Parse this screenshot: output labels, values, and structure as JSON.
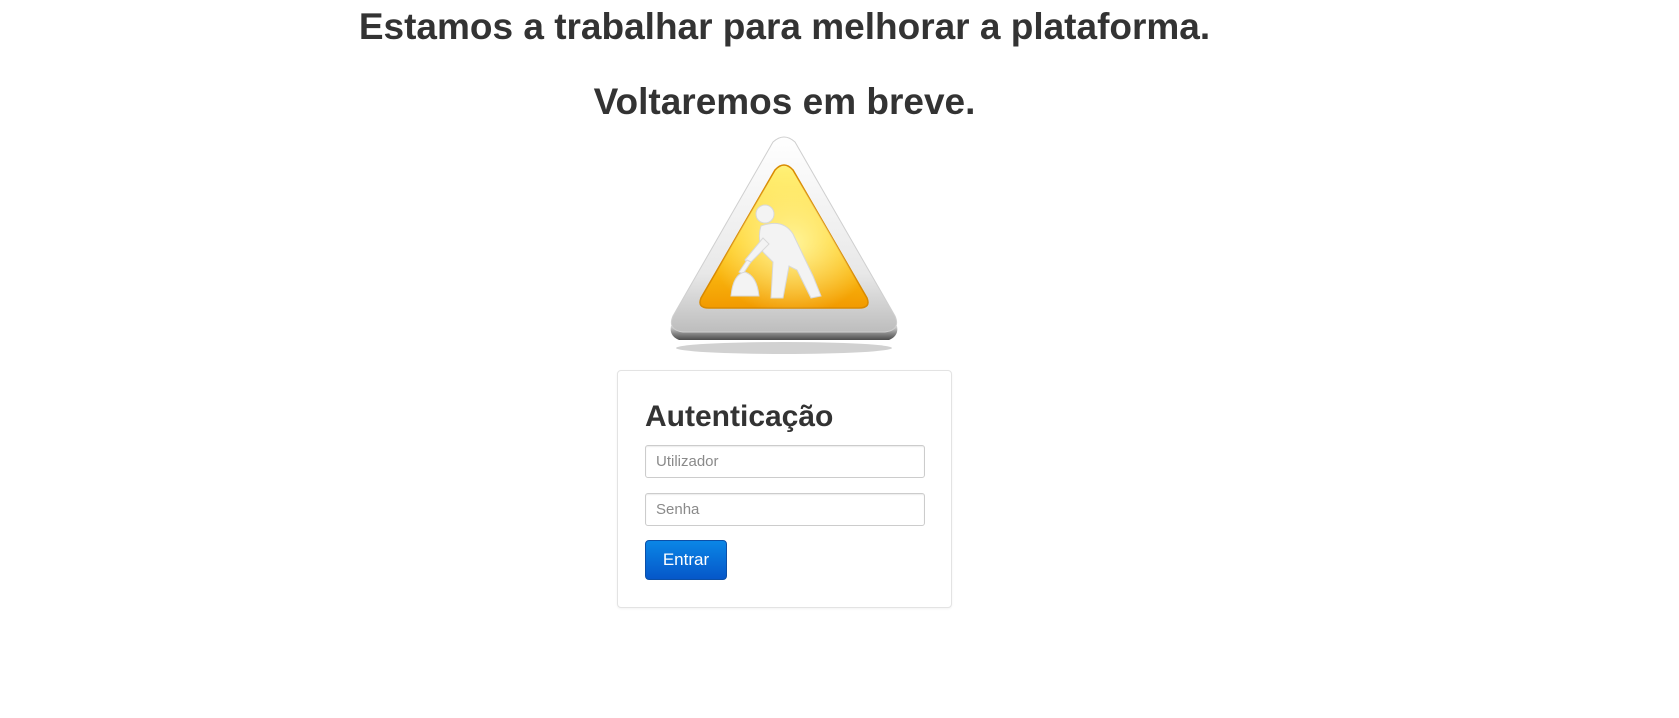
{
  "headline": {
    "line1": "Estamos a trabalhar para melhorar a plataforma.",
    "line2": "Voltaremos em breve."
  },
  "sign": {
    "icon": "under-construction-warning-sign",
    "colors": {
      "frame": "#e6e6e6",
      "fill_top": "#ffe95a",
      "fill_bottom": "#f7a600",
      "figure": "#f2f2f2"
    }
  },
  "login": {
    "title": "Autenticação",
    "username_placeholder": "Utilizador",
    "username_value": "",
    "password_placeholder": "Senha",
    "password_value": "",
    "submit_label": "Entrar",
    "button_color": "#0a6fd8"
  }
}
